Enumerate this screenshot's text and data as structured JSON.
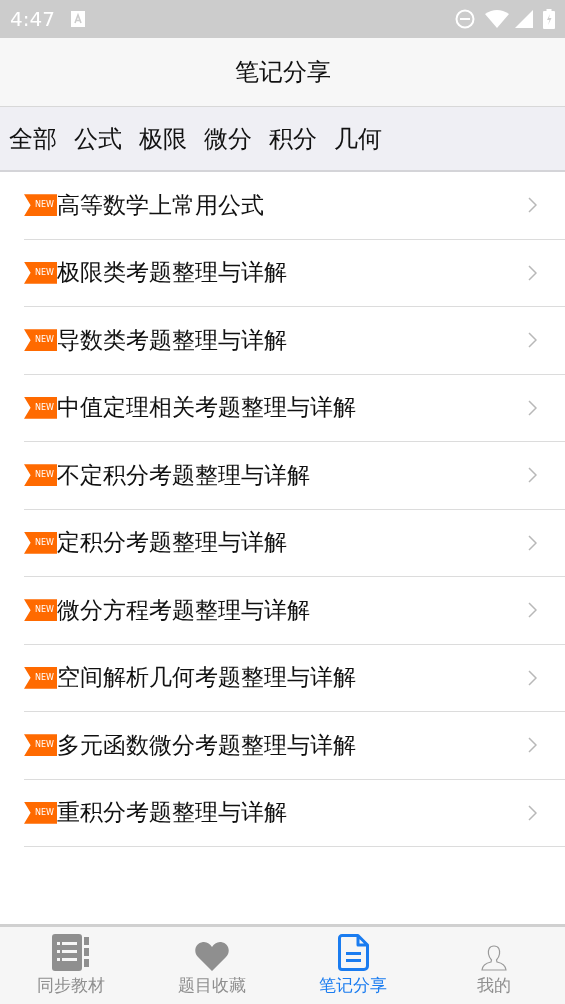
{
  "status_bar": {
    "time": "4:47"
  },
  "header": {
    "title": "笔记分享"
  },
  "categories": [
    "全部",
    "公式",
    "极限",
    "微分",
    "积分",
    "几何"
  ],
  "notes": [
    {
      "badge": "NEW",
      "title": "高等数学上常用公式"
    },
    {
      "badge": "NEW",
      "title": "极限类考题整理与详解"
    },
    {
      "badge": "NEW",
      "title": "导数类考题整理与详解"
    },
    {
      "badge": "NEW",
      "title": "中值定理相关考题整理与详解"
    },
    {
      "badge": "NEW",
      "title": "不定积分考题整理与详解"
    },
    {
      "badge": "NEW",
      "title": "定积分考题整理与详解"
    },
    {
      "badge": "NEW",
      "title": "微分方程考题整理与详解"
    },
    {
      "badge": "NEW",
      "title": "空间解析几何考题整理与详解"
    },
    {
      "badge": "NEW",
      "title": "多元函数微分考题整理与详解"
    },
    {
      "badge": "NEW",
      "title": "重积分考题整理与详解"
    }
  ],
  "bottom_nav": [
    {
      "kind": "book",
      "label": "同步教材",
      "selected": false
    },
    {
      "kind": "heart",
      "label": "题目收藏",
      "selected": false
    },
    {
      "kind": "document",
      "label": "笔记分享",
      "selected": true
    },
    {
      "kind": "person",
      "label": "我的",
      "selected": false
    }
  ]
}
